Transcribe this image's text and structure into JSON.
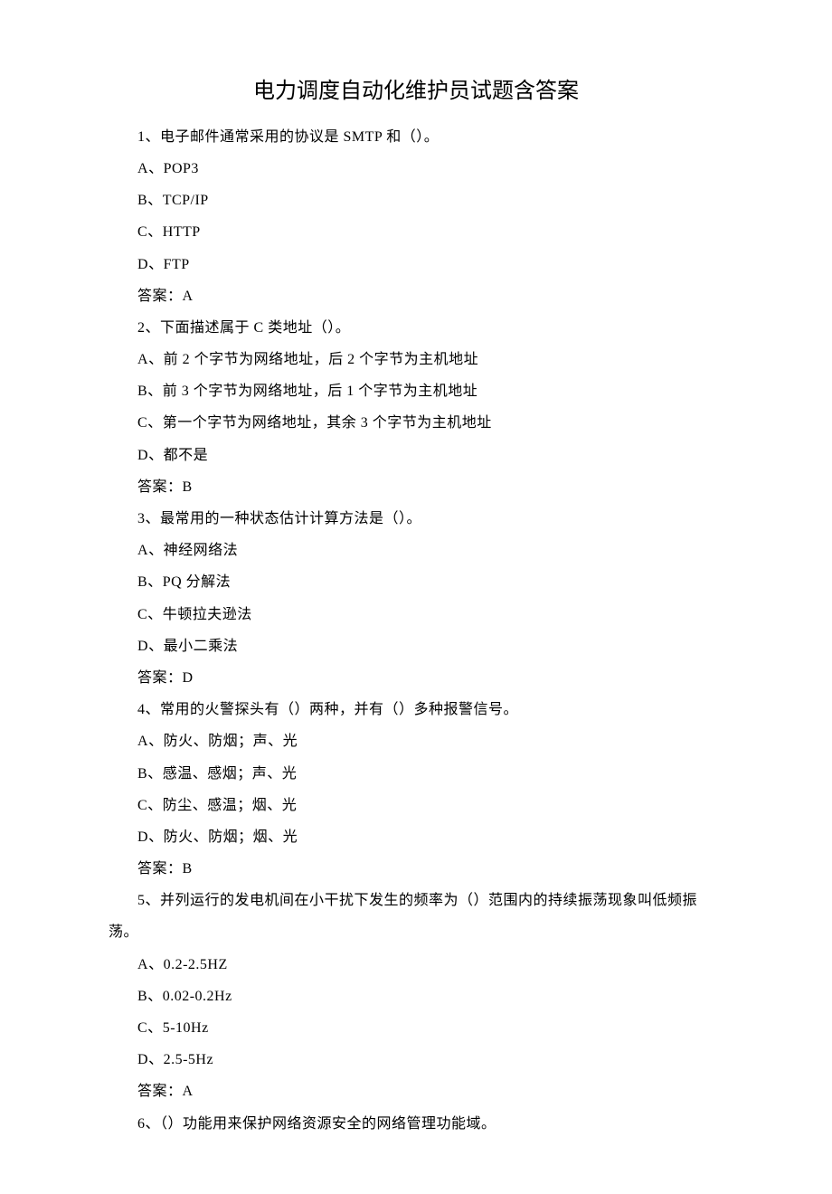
{
  "title": "电力调度自动化维护员试题含答案",
  "questions": [
    {
      "num": "1",
      "stem": "电子邮件通常采用的协议是 SMTP 和（）。",
      "options": [
        {
          "letter": "A",
          "text": "POP3"
        },
        {
          "letter": "B",
          "text": "TCP/IP"
        },
        {
          "letter": "C",
          "text": "HTTP"
        },
        {
          "letter": "D",
          "text": "FTP"
        }
      ],
      "answer": "A"
    },
    {
      "num": "2",
      "stem": "下面描述属于 C 类地址（）。",
      "options": [
        {
          "letter": "A",
          "text": "前 2 个字节为网络地址，后 2 个字节为主机地址"
        },
        {
          "letter": "B",
          "text": "前 3 个字节为网络地址，后 1 个字节为主机地址"
        },
        {
          "letter": "C",
          "text": "第一个字节为网络地址，其余 3 个字节为主机地址"
        },
        {
          "letter": "D",
          "text": "都不是"
        }
      ],
      "answer": "B"
    },
    {
      "num": "3",
      "stem": "最常用的一种状态估计计算方法是（）。",
      "options": [
        {
          "letter": "A",
          "text": "神经网络法"
        },
        {
          "letter": "B",
          "text": "PQ 分解法"
        },
        {
          "letter": "C",
          "text": "牛顿拉夫逊法"
        },
        {
          "letter": "D",
          "text": "最小二乘法"
        }
      ],
      "answer": "D"
    },
    {
      "num": "4",
      "stem": "常用的火警探头有（）两种，并有（）多种报警信号。",
      "options": [
        {
          "letter": "A",
          "text": "防火、防烟；声、光"
        },
        {
          "letter": "B",
          "text": "感温、感烟；声、光"
        },
        {
          "letter": "C",
          "text": "防尘、感温；烟、光"
        },
        {
          "letter": "D",
          "text": "防火、防烟；烟、光"
        }
      ],
      "answer": "B"
    },
    {
      "num": "5",
      "stem": "并列运行的发电机间在小干扰下发生的频率为（）范围内的持续振荡现象叫低频振荡。",
      "options": [
        {
          "letter": "A",
          "text": "0.2-2.5HZ"
        },
        {
          "letter": "B",
          "text": "0.02-0.2Hz"
        },
        {
          "letter": "C",
          "text": "5-10Hz"
        },
        {
          "letter": "D",
          "text": "2.5-5Hz"
        }
      ],
      "answer": "A"
    },
    {
      "num": "6",
      "stem": "（）功能用来保护网络资源安全的网络管理功能域。"
    }
  ],
  "labels": {
    "answer_prefix": "答案：",
    "option_sep": "、",
    "stem_sep": "、"
  }
}
